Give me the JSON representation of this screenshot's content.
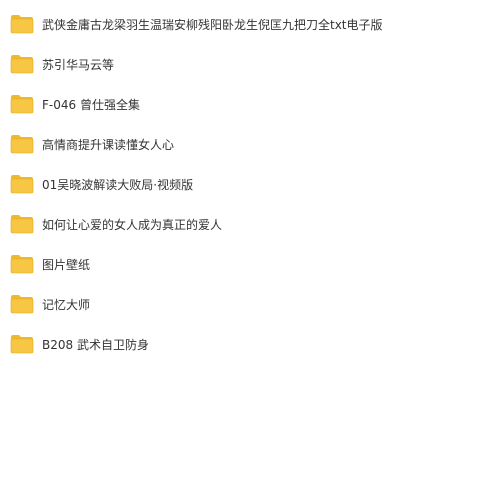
{
  "colors": {
    "folder_body": "#F6C644",
    "folder_tab": "#F1B92C",
    "folder_edge": "#E5AA1E",
    "text": "#333333",
    "background": "#FFFFFF"
  },
  "folders": [
    {
      "name": "武侠金庸古龙梁羽生温瑞安柳残阳卧龙生倪匡九把刀全txt电子版",
      "icon": "folder-icon"
    },
    {
      "name": "苏引华马云等",
      "icon": "folder-icon"
    },
    {
      "name": "F-046 曾仕强全集",
      "icon": "folder-icon"
    },
    {
      "name": "高情商提升课读懂女人心",
      "icon": "folder-icon"
    },
    {
      "name": "01吴晓波解读大败局·视频版",
      "icon": "folder-icon"
    },
    {
      "name": "如何让心爱的女人成为真正的爱人",
      "icon": "folder-icon"
    },
    {
      "name": "图片壁纸",
      "icon": "folder-icon"
    },
    {
      "name": "记忆大师",
      "icon": "folder-icon"
    },
    {
      "name": "B208  武术自卫防身",
      "icon": "folder-icon"
    }
  ]
}
